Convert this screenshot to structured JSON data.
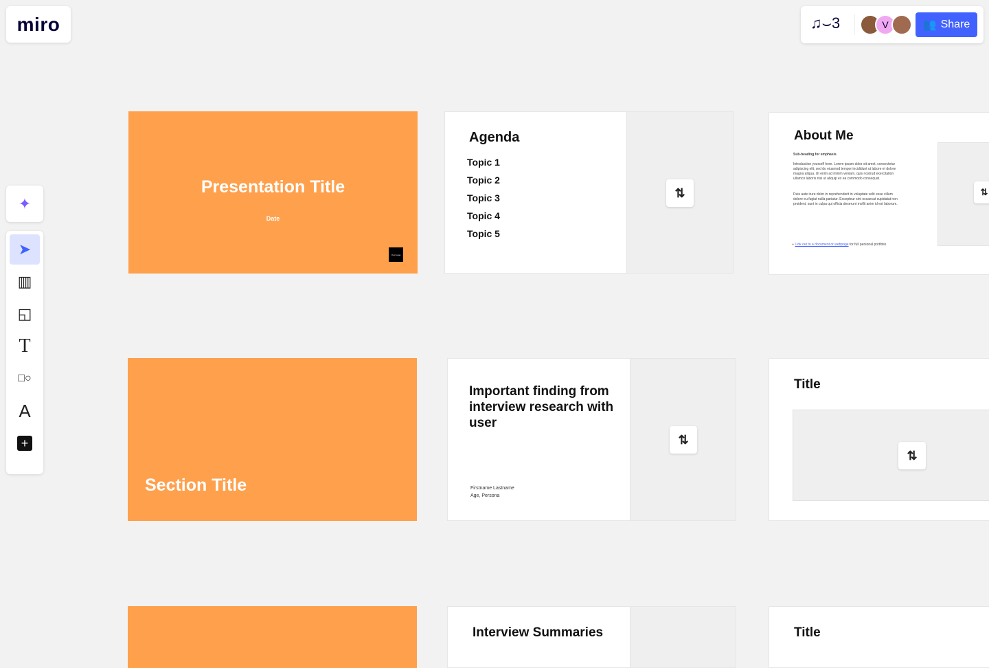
{
  "app": {
    "logo": "miro"
  },
  "header": {
    "share_label": "Share",
    "avatars": [
      "photo-user-1",
      "V",
      "photo-user-3"
    ],
    "accent": "#4262ff"
  },
  "toolbar": {
    "items": [
      "ai-assist",
      "select",
      "templates",
      "sticky-note",
      "text",
      "shapes",
      "pen",
      "add"
    ]
  },
  "frames": {
    "title_slide": {
      "title": "Presentation Title",
      "date": "Date",
      "logo": "Your Logo"
    },
    "agenda": {
      "title": "Agenda",
      "topics": [
        "Topic 1",
        "Topic 2",
        "Topic 3",
        "Topic 4",
        "Topic 5"
      ]
    },
    "about": {
      "title": "About Me",
      "subheading": "Sub-heading for emphasis",
      "p1": "Introduction yourself here. Lorem ipsum dolor sit amet, consectetur adipiscing elit, sed do eiusmod tempor incididunt ut labore et dolore magna aliqua. Ut enim ad minim veniam, quis nostrud exercitation ullamco laboris nisi ut aliquip ex ea commodo consequat.",
      "p2": "Duis aute irure dolor in reprehenderit in voluptate velit esse cillum dolore eu fugiat nulla pariatur. Excepteur sint occaecat cupidatat non proident, sunt in culpa qui officia deserunt mollit anim id est laborum.",
      "link": "Link out to a document or webpage",
      "link_suffix": " for full personal portfolio"
    },
    "section": {
      "title": "Section Title"
    },
    "finding": {
      "title": "Important finding from interview research with user",
      "name": "Firstname Lastname",
      "meta": "Age, Persona"
    },
    "title_image": {
      "title": "Title"
    },
    "summaries": {
      "title": "Interview Summaries"
    },
    "title3": {
      "title": "Title"
    }
  },
  "colors": {
    "orange": "#ffa04c",
    "canvas": "#f2f2f2"
  }
}
